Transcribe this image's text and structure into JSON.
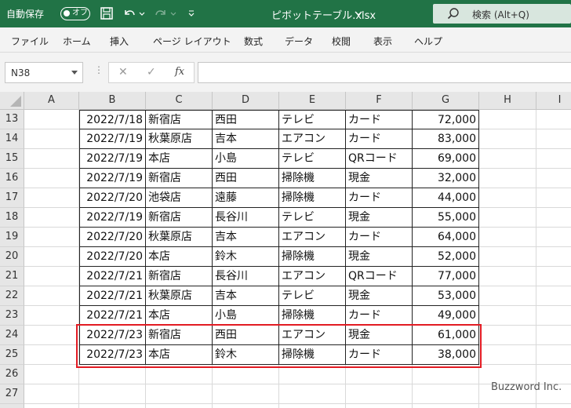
{
  "titlebar": {
    "autosave_label": "自動保存",
    "autosave_state": "オフ",
    "file_title": "ピボットテーブル.xlsx",
    "search_placeholder": "検索 (Alt+Q)"
  },
  "menu": [
    "ファイル",
    "ホーム",
    "挿入",
    "ページ レイアウト",
    "数式",
    "データ",
    "校閲",
    "表示",
    "ヘルプ"
  ],
  "formula_bar": {
    "name_box": "N38",
    "cancel_glyph": "✕",
    "enter_glyph": "✓",
    "function_glyph": "fx",
    "formula": ""
  },
  "grid": {
    "columns": [
      "A",
      "B",
      "C",
      "D",
      "E",
      "F",
      "G",
      "H",
      "I"
    ],
    "rows": [
      {
        "row": "13",
        "date": "2022/7/18",
        "store": "新宿店",
        "person": "西田",
        "product": "テレビ",
        "payment": "カード",
        "amount": "72,000"
      },
      {
        "row": "14",
        "date": "2022/7/19",
        "store": "秋葉原店",
        "person": "吉本",
        "product": "エアコン",
        "payment": "カード",
        "amount": "83,000"
      },
      {
        "row": "15",
        "date": "2022/7/19",
        "store": "本店",
        "person": "小島",
        "product": "テレビ",
        "payment": "QRコード",
        "amount": "69,000"
      },
      {
        "row": "16",
        "date": "2022/7/19",
        "store": "新宿店",
        "person": "西田",
        "product": "掃除機",
        "payment": "現金",
        "amount": "32,000"
      },
      {
        "row": "17",
        "date": "2022/7/20",
        "store": "池袋店",
        "person": "遠藤",
        "product": "掃除機",
        "payment": "カード",
        "amount": "44,000"
      },
      {
        "row": "18",
        "date": "2022/7/19",
        "store": "新宿店",
        "person": "長谷川",
        "product": "テレビ",
        "payment": "現金",
        "amount": "55,000"
      },
      {
        "row": "19",
        "date": "2022/7/20",
        "store": "秋葉原店",
        "person": "吉本",
        "product": "エアコン",
        "payment": "カード",
        "amount": "64,000"
      },
      {
        "row": "20",
        "date": "2022/7/20",
        "store": "本店",
        "person": "鈴木",
        "product": "掃除機",
        "payment": "現金",
        "amount": "52,000"
      },
      {
        "row": "21",
        "date": "2022/7/21",
        "store": "新宿店",
        "person": "長谷川",
        "product": "エアコン",
        "payment": "QRコード",
        "amount": "77,000"
      },
      {
        "row": "22",
        "date": "2022/7/21",
        "store": "秋葉原店",
        "person": "吉本",
        "product": "テレビ",
        "payment": "現金",
        "amount": "53,000"
      },
      {
        "row": "23",
        "date": "2022/7/21",
        "store": "本店",
        "person": "小島",
        "product": "掃除機",
        "payment": "カード",
        "amount": "49,000"
      },
      {
        "row": "24",
        "date": "2022/7/23",
        "store": "新宿店",
        "person": "西田",
        "product": "エアコン",
        "payment": "現金",
        "amount": "61,000"
      },
      {
        "row": "25",
        "date": "2022/7/23",
        "store": "本店",
        "person": "鈴木",
        "product": "掃除機",
        "payment": "カード",
        "amount": "38,000"
      }
    ],
    "empty_rows": [
      "26",
      "27",
      "28"
    ]
  },
  "watermark": "Buzzword Inc.",
  "colors": {
    "accent": "#217346",
    "highlight": "#e21b23"
  }
}
